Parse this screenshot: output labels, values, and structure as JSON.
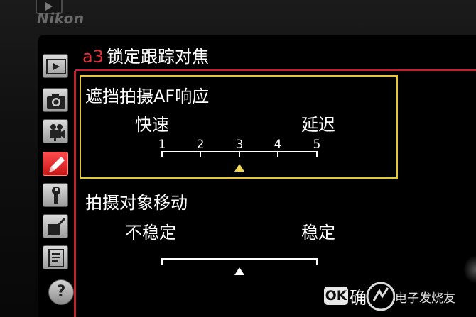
{
  "camera": {
    "brand": "Nikon"
  },
  "menu": {
    "code": "a3",
    "title": "锁定跟踪对焦",
    "tabs": [
      {
        "icon": "playback-icon"
      },
      {
        "icon": "camera-icon"
      },
      {
        "icon": "movie-camera-icon"
      },
      {
        "icon": "pencil-icon",
        "active": true
      },
      {
        "icon": "wrench-icon"
      },
      {
        "icon": "retouch-icon"
      },
      {
        "icon": "my-menu-icon"
      },
      {
        "icon": "help-icon",
        "label": "?"
      }
    ]
  },
  "settings": [
    {
      "label": "遮挡拍摄AF响应",
      "left_label": "快速",
      "right_label": "延迟",
      "scale_numbers": [
        "1",
        "2",
        "3",
        "4",
        "5"
      ],
      "selected": 3,
      "highlight_color": "#e8c53a"
    },
    {
      "label": "拍摄对象移动",
      "left_label": "不稳定",
      "right_label": "稳定",
      "selected": 3
    }
  ],
  "footer": {
    "ok_button": "OK",
    "ok_label": "确"
  },
  "watermark": {
    "text": "电子发烧友"
  },
  "colors": {
    "accent_red": "#c8202b",
    "highlight_yellow": "#e8c53a"
  }
}
